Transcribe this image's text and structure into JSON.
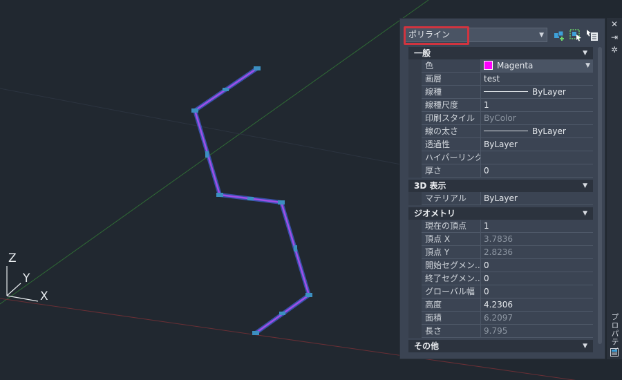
{
  "viewport": {
    "ucs": {
      "z_label": "Z",
      "y_label": "Y",
      "x_label": "X"
    }
  },
  "panel": {
    "object_type": "ポリライン",
    "strip_title": "プロパティ",
    "colors": {
      "accent_highlight": "#d1343f",
      "entity_color": "#ff00ff"
    },
    "icons": [
      "quick-select-icon",
      "select-objects-icon",
      "toggle-pickadd-icon"
    ],
    "sections": [
      {
        "title": "一般",
        "rows": [
          {
            "label": "色",
            "value": "Magenta",
            "kind": "color",
            "swatch": "#ff00ff"
          },
          {
            "label": "画層",
            "value": "test"
          },
          {
            "label": "線種",
            "value": "ByLayer",
            "kind": "line"
          },
          {
            "label": "線種尺度",
            "value": "1"
          },
          {
            "label": "印刷スタイル",
            "value": "ByColor",
            "dim": true
          },
          {
            "label": "線の太さ",
            "value": "ByLayer",
            "kind": "line"
          },
          {
            "label": "透過性",
            "value": "ByLayer"
          },
          {
            "label": "ハイパーリンク",
            "value": ""
          },
          {
            "label": "厚さ",
            "value": "0"
          }
        ]
      },
      {
        "title": "3D 表示",
        "rows": [
          {
            "label": "マテリアル",
            "value": "ByLayer"
          }
        ]
      },
      {
        "title": "ジオメトリ",
        "rows": [
          {
            "label": "現在の頂点",
            "value": "1"
          },
          {
            "label": "頂点 X",
            "value": "3.7836",
            "dim": true
          },
          {
            "label": "頂点 Y",
            "value": "2.8236",
            "dim": true
          },
          {
            "label": "開始セグメン...",
            "value": "0"
          },
          {
            "label": "終了セグメン...",
            "value": "0"
          },
          {
            "label": "グローバル幅",
            "value": "0"
          },
          {
            "label": "高度",
            "value": "4.2306"
          },
          {
            "label": "面積",
            "value": "6.2097",
            "dim": true
          },
          {
            "label": "長さ",
            "value": "9.795",
            "dim": true
          }
        ]
      },
      {
        "title": "その他",
        "rows": []
      }
    ]
  }
}
